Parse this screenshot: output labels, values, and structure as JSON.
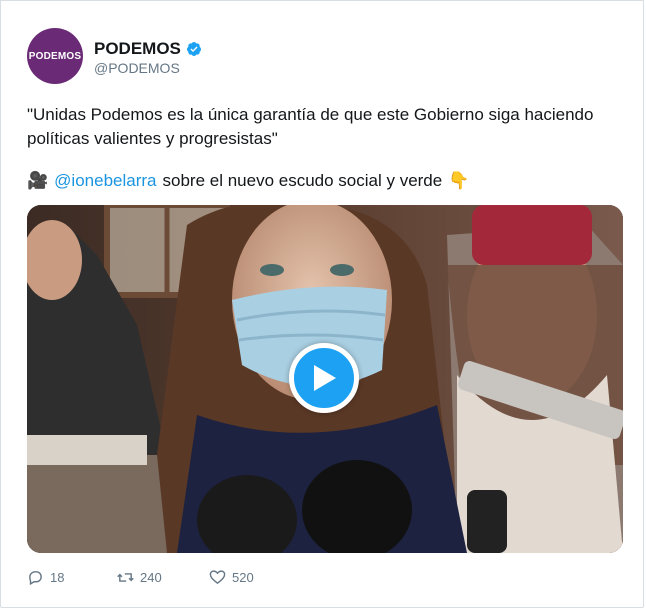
{
  "account": {
    "avatar_text": "PODEMOS",
    "display_name": "PODEMOS",
    "handle": "@PODEMOS",
    "verified": true
  },
  "tweet": {
    "text": "\"Unidas Podemos es la única garantía de que este Gobierno siga haciendo políticas valientes y progresistas\"",
    "camera_emoji": "🎥",
    "mention": "@ionebelarra",
    "mention_suffix": "sobre el nuevo escudo social y verde",
    "pointing_emoji": "👇"
  },
  "media": {
    "type": "video",
    "play_icon": "play-icon"
  },
  "actions": {
    "replies": "18",
    "retweets": "240",
    "likes": "520"
  },
  "colors": {
    "link": "#1b95e0",
    "play": "#1da1f2",
    "avatar_bg": "#6a2a75",
    "meta": "#657786"
  }
}
